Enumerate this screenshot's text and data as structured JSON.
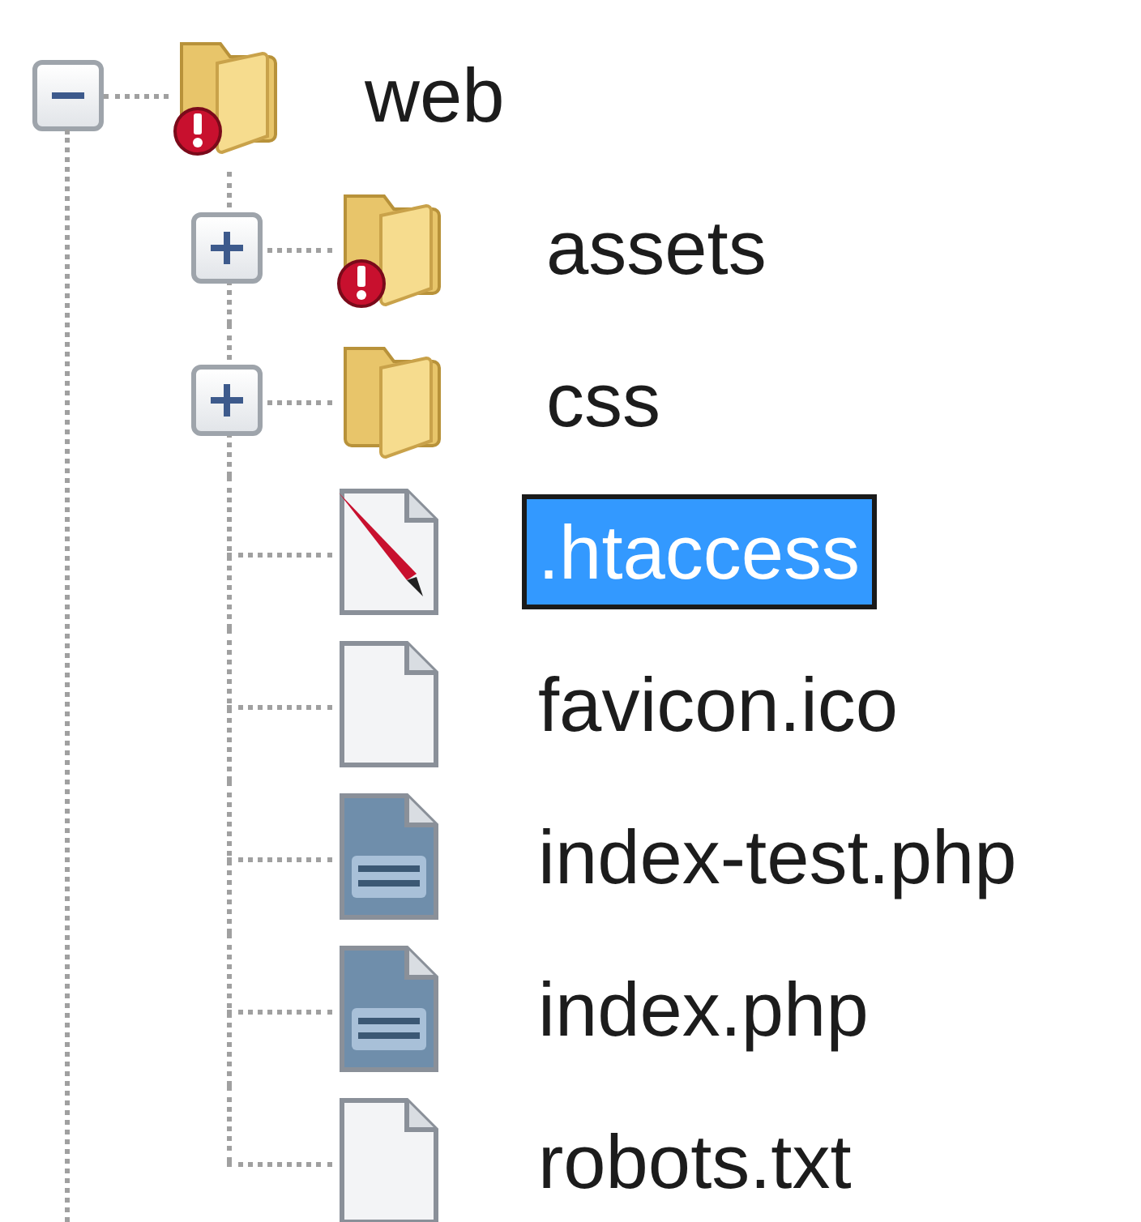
{
  "tree": {
    "label": "web",
    "kind": "folder",
    "expanded": true,
    "error": true,
    "selected": false,
    "children": [
      {
        "label": "assets",
        "kind": "folder",
        "expanded": false,
        "error": true,
        "selected": false
      },
      {
        "label": "css",
        "kind": "folder",
        "expanded": false,
        "error": false,
        "selected": false
      },
      {
        "label": ".htaccess",
        "kind": "config",
        "error": false,
        "selected": true
      },
      {
        "label": "favicon.ico",
        "kind": "file",
        "error": false,
        "selected": false
      },
      {
        "label": "index-test.php",
        "kind": "php",
        "error": false,
        "selected": false
      },
      {
        "label": "index.php",
        "kind": "php",
        "error": false,
        "selected": false
      },
      {
        "label": "robots.txt",
        "kind": "file",
        "error": false,
        "selected": false
      }
    ]
  }
}
